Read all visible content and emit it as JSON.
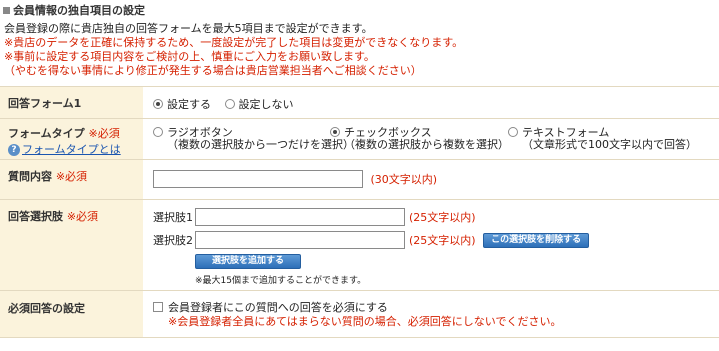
{
  "section_title": "会員情報の独自項目の設定",
  "intro": {
    "line1": "会員登録の際に貴店独自の回答フォームを最大5項目まで設定ができます。",
    "warn1": "※貴店のデータを正確に保持するため、一度設定が完了した項目は変更ができなくなります。",
    "warn2": "※事前に設定する項目内容をご検討の上、慎重にご入力をお願い致します。",
    "warn3": "（やむを得ない事情により修正が発生する場合は貴店営業担当者へご相談ください）"
  },
  "rows": {
    "form1": {
      "label": "回答フォーム1",
      "opt_on": "設定する",
      "opt_off": "設定しない",
      "selected": "設定する"
    },
    "type": {
      "label": "フォームタイプ",
      "required": "※必須",
      "help_link": "フォームタイプとは",
      "options": [
        {
          "label": "ラジオボタン",
          "desc": "（複数の選択肢から一つだけを選択）"
        },
        {
          "label": "チェックボックス",
          "desc": "（複数の選択肢から複数を選択）"
        },
        {
          "label": "テキストフォーム",
          "desc": "（文章形式で100文字以内で回答）"
        }
      ],
      "selected": "チェックボックス"
    },
    "question": {
      "label": "質問内容",
      "required": "※必須",
      "value": "",
      "limit": "(30文字以内)"
    },
    "choices": {
      "label": "回答選択肢",
      "required": "※必須",
      "items": [
        {
          "label": "選択肢1",
          "value": "",
          "limit": "(25文字以内)"
        },
        {
          "label": "選択肢2",
          "value": "",
          "limit": "(25文字以内)"
        }
      ],
      "delete_button": "この選択肢を削除する",
      "add_button": "選択肢を追加する",
      "max_note": "※最大15個まで追加することができます。"
    },
    "mandatory": {
      "label": "必須回答の設定",
      "checkbox_label": "会員登録者にこの質問への回答を必須にする",
      "note": "※会員登録者全員にあてはまらない質問の場合、必須回答にしないでください。"
    }
  },
  "colors": {
    "label_bg": "#fbf3dc",
    "red": "#d52000",
    "link": "#1a55b0",
    "button": "#2d6fb8"
  }
}
